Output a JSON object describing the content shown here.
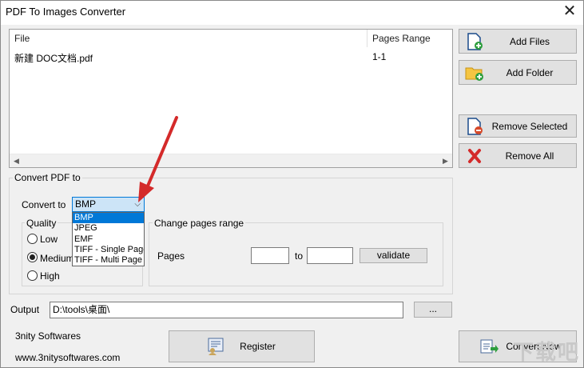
{
  "window": {
    "title": "PDF To Images Converter"
  },
  "file_list": {
    "columns": [
      "File",
      "Pages Range"
    ],
    "rows": [
      {
        "file": "新建 DOC文档.pdf",
        "range": "1-1"
      }
    ]
  },
  "side_buttons": {
    "add_files": "Add Files",
    "add_folder": "Add Folder",
    "remove_selected": "Remove Selected",
    "remove_all": "Remove All"
  },
  "convert_group": {
    "title": "Convert PDF to",
    "convert_to_label": "Convert to",
    "selected": "BMP",
    "options": [
      "BMP",
      "JPEG",
      "EMF",
      "TIFF - Single Page",
      "TIFF - Multi Page"
    ]
  },
  "quality": {
    "title": "Quality",
    "options": [
      "Low",
      "Medium",
      "High"
    ],
    "selected": "Medium"
  },
  "pages_range": {
    "title": "Change pages range",
    "pages_label": "Pages",
    "from_value": "",
    "to_label": "to",
    "to_value": "",
    "validate_label": "validate"
  },
  "output": {
    "label": "Output",
    "value": "D:\\tools\\桌面\\",
    "browse_label": "..."
  },
  "footer": {
    "company": "3nity Softwares",
    "website": "www.3nitysoftwares.com",
    "register_label": "Register",
    "convert_label": "Convert Now"
  },
  "watermark": "下载吧",
  "colors": {
    "accent": "#0078d7",
    "arrow": "#d42a2a"
  }
}
